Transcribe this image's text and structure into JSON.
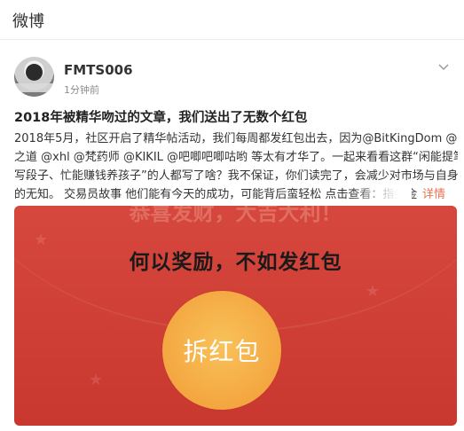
{
  "app": {
    "title": "微博"
  },
  "post": {
    "username": "FMTS006",
    "time": "1分钟前",
    "title": "2018年被精华吻过的文章，我们送出了无数个红包",
    "body_lines": [
      "2018年5月，社区开启了精华帖活动，我们每周都发红包出去，因为@BitKingDom @反",
      "之道 @xhl @梵药师 @KIKIL @吧唧吧唧咕哟 等太有才华了。一起来看看这群“闲能提笔",
      "写段子、忙能赚钱养孩子”的人都写了啥？我不保证，你们读完了，会减少对市场与自身",
      "的无知。 交易员故事 他们能有今天的成功，可能背后蛮轻松 点击查看：指尖金"
    ],
    "detail_link": "详情"
  },
  "envelope": {
    "top_text": "恭喜发财，大吉大利！",
    "headline": "何以奖励，不如发红包",
    "open_label": "拆红包"
  },
  "colors": {
    "envelope_red": "#cf4037",
    "button_orange": "#f4a640",
    "link_orange": "#eb7350"
  },
  "icons": {
    "more": "chevron-down-icon",
    "avatar": "user-avatar"
  }
}
